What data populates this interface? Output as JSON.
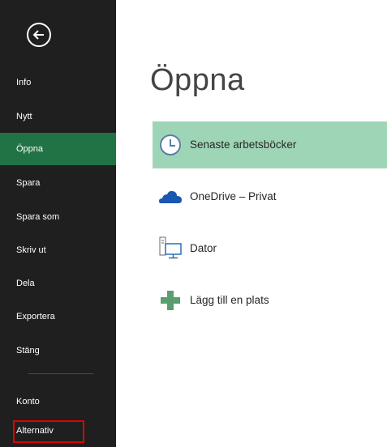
{
  "sidebar": {
    "back_icon": "back-arrow-icon",
    "items": [
      {
        "label": "Info"
      },
      {
        "label": "Nytt"
      },
      {
        "label": "Öppna"
      },
      {
        "label": "Spara"
      },
      {
        "label": "Spara som"
      },
      {
        "label": "Skriv ut"
      },
      {
        "label": "Dela"
      },
      {
        "label": "Exportera"
      },
      {
        "label": "Stäng"
      },
      {
        "label": "Konto"
      },
      {
        "label": "Alternativ"
      }
    ],
    "active_item": "Öppna",
    "highlighted_item": "Alternativ"
  },
  "main": {
    "title": "Öppna",
    "locations": [
      {
        "label": "Senaste arbetsböcker",
        "icon": "clock-icon"
      },
      {
        "label": "OneDrive – Privat",
        "icon": "cloud-icon"
      },
      {
        "label": "Dator",
        "icon": "computer-icon"
      },
      {
        "label": "Lägg till en plats",
        "icon": "plus-icon"
      }
    ],
    "selected_location": "Senaste arbetsböcker"
  },
  "colors": {
    "sidebar_bg": "#1f1f1f",
    "accent_green": "#217346",
    "selected_location_bg": "#9fd5b7",
    "highlight_outline": "#e00000",
    "onedrive_blue": "#1a58b0",
    "plus_green": "#5a9e6f"
  }
}
